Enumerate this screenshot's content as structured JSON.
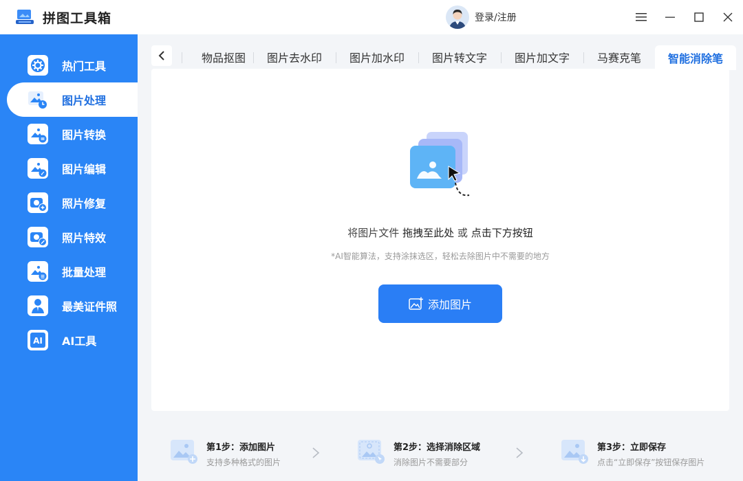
{
  "app": {
    "title": "拼图工具箱",
    "user_label": "登录/注册"
  },
  "window_controls": [
    "menu-icon",
    "minimize-icon",
    "maximize-icon",
    "close-icon"
  ],
  "sidebar": {
    "items": [
      {
        "label": "热门工具",
        "icon": "gear-icon"
      },
      {
        "label": "图片处理",
        "icon": "image-clock-icon",
        "active": true
      },
      {
        "label": "图片转换",
        "icon": "image-convert-icon"
      },
      {
        "label": "图片编辑",
        "icon": "image-edit-icon"
      },
      {
        "label": "照片修复",
        "icon": "camera-plus-icon"
      },
      {
        "label": "照片特效",
        "icon": "camera-magic-icon"
      },
      {
        "label": "批量处理",
        "icon": "image-batch-icon"
      },
      {
        "label": "最美证件照",
        "icon": "id-photo-icon"
      },
      {
        "label": "AI工具",
        "icon": "ai-icon"
      }
    ]
  },
  "tabs": [
    {
      "label": "物品抠图"
    },
    {
      "label": "图片去水印"
    },
    {
      "label": "图片加水印"
    },
    {
      "label": "图片转文字"
    },
    {
      "label": "图片加文字"
    },
    {
      "label": "马赛克笔"
    },
    {
      "label": "智能消除笔",
      "active": true
    }
  ],
  "main": {
    "hint_prefix": "将图片文件",
    "hint_drag": "拖拽至此处",
    "hint_or": "或",
    "hint_click": "点击下方按钮",
    "sub_hint": "*AI智能算法，支持涂抹选区，轻松去除图片中不需要的地方",
    "add_button": "添加图片"
  },
  "steps": [
    {
      "title": "第1步：添加图片",
      "desc": "支持多种格式的图片"
    },
    {
      "title": "第2步：选择消除区域",
      "desc": "消除图片不需要部分"
    },
    {
      "title": "第3步：立即保存",
      "desc": "点击“立即保存”按钮保存图片"
    }
  ],
  "colors": {
    "accent": "#2a85f6",
    "button": "#2a7ef5",
    "active_tab_text": "#1f6fe0"
  }
}
